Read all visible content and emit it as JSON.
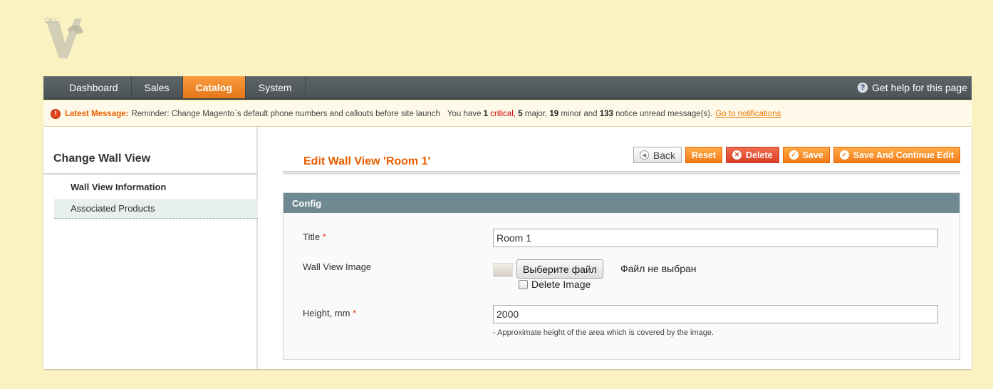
{
  "logo_icon": "vc-logo-icon",
  "nav": {
    "items": [
      {
        "label": "Dashboard",
        "active": false
      },
      {
        "label": "Sales",
        "active": false
      },
      {
        "label": "Catalog",
        "active": true
      },
      {
        "label": "System",
        "active": false
      }
    ],
    "help_label": "Get help for this page",
    "help_icon": "question-icon"
  },
  "notice": {
    "latest_label": "Latest Message:",
    "message": "Reminder: Change Magento`s default phone numbers and callouts before site launch",
    "you_have": "You have",
    "critical_count": "1",
    "critical_label": "critical,",
    "major_count": "5",
    "major_label": "major,",
    "minor_count": "19",
    "minor_label": "minor and",
    "notice_count": "133",
    "notice_label": "notice unread message(s).",
    "link": "Go to notifications"
  },
  "sidebar": {
    "title": "Change Wall View",
    "tabs": [
      {
        "label": "Wall View Information",
        "active": true
      },
      {
        "label": "Associated Products",
        "active": false
      }
    ]
  },
  "page": {
    "title": "Edit Wall View 'Room 1'",
    "buttons": {
      "back": "Back",
      "reset": "Reset",
      "delete": "Delete",
      "save": "Save",
      "save_continue": "Save And Continue Edit"
    }
  },
  "config": {
    "header": "Config",
    "title_label": "Title",
    "title_value": "Room 1",
    "image_label": "Wall View Image",
    "file_button": "Выберите файл",
    "file_status": "Файл не выбран",
    "delete_image_label": "Delete Image",
    "height_label": "Height, mm",
    "height_value": "2000",
    "height_hint": "- Approximate height of the area which is covered by the image.",
    "required_mark": "*"
  },
  "colors": {
    "background": "#faf2c0",
    "accent": "#eb5e00",
    "nav": "#525a5d",
    "panel_header": "#6f8992"
  }
}
